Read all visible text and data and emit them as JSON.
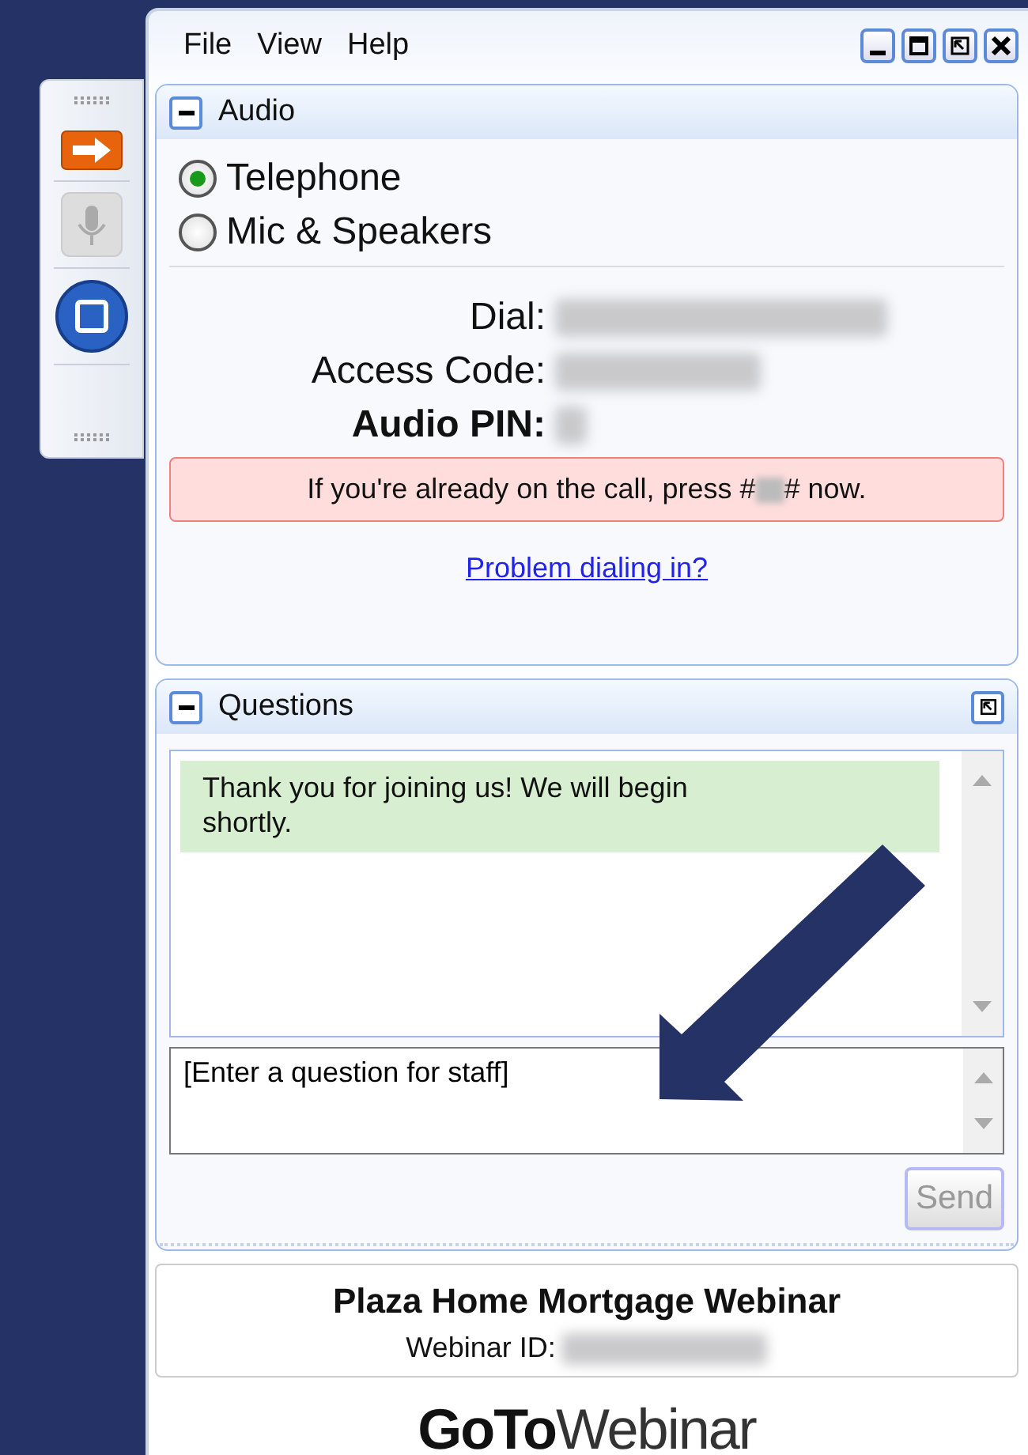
{
  "menu": [
    "File",
    "View",
    "Help"
  ],
  "audio": {
    "title": "Audio",
    "options": [
      {
        "label": "Telephone",
        "selected": true
      },
      {
        "label": "Mic & Speakers",
        "selected": false
      }
    ],
    "fields": [
      {
        "label": "Dial:",
        "bold": false
      },
      {
        "label": "Access Code:",
        "bold": false
      },
      {
        "label": "Audio PIN:",
        "bold": true
      }
    ],
    "notice": {
      "before": "If you're already on the call, press #",
      "after": "# now."
    },
    "link": "Problem dialing in?"
  },
  "questions": {
    "title": "Questions",
    "messages": [
      "Thank you for joining us! We will begin shortly."
    ],
    "input": {
      "value": "[Enter a question for staff]"
    },
    "send": {
      "label": "Send",
      "disabled": true
    }
  },
  "footer": {
    "title": "Plaza Home Mortgage Webinar",
    "id_label": "Webinar ID:"
  },
  "logo": {
    "bold": "GoTo",
    "light": "Webinar"
  }
}
